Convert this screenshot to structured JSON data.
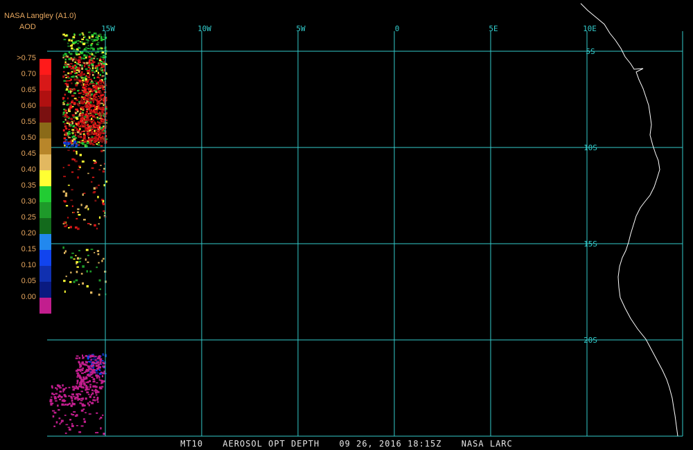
{
  "header": {
    "title": "NASA Langley (A1.0)",
    "unit": "AOD"
  },
  "legend": {
    "labels": [
      ">0.75",
      "0.70",
      "0.65",
      "0.60",
      "0.55",
      "0.50",
      "0.45",
      "0.40",
      "0.35",
      "0.30",
      "0.25",
      "0.20",
      "0.15",
      "0.10",
      "0.05",
      "0.00"
    ],
    "colors": [
      "#ff1a1a",
      "#d81818",
      "#b01010",
      "#7a1010",
      "#8a6a18",
      "#b8862a",
      "#e2b860",
      "#ffff33",
      "#22cc33",
      "#1e9a2a",
      "#136a1c",
      "#2288ee",
      "#1144ee",
      "#1030b0",
      "#0a1a80",
      "#c21e8e"
    ]
  },
  "map": {
    "lon_labels": [
      "15W",
      "10W",
      "5W",
      "0",
      "5E",
      "10E"
    ],
    "lat_labels": [
      "5S",
      "10S",
      "15S",
      "20S"
    ],
    "grid_color": "#33cccc",
    "coast_color": "#ffffff"
  },
  "footer": {
    "product": "MT10",
    "name": "AEROSOL OPT DEPTH",
    "datetime": "09 26, 2016 18:15Z",
    "source": "NASA LARC"
  }
}
